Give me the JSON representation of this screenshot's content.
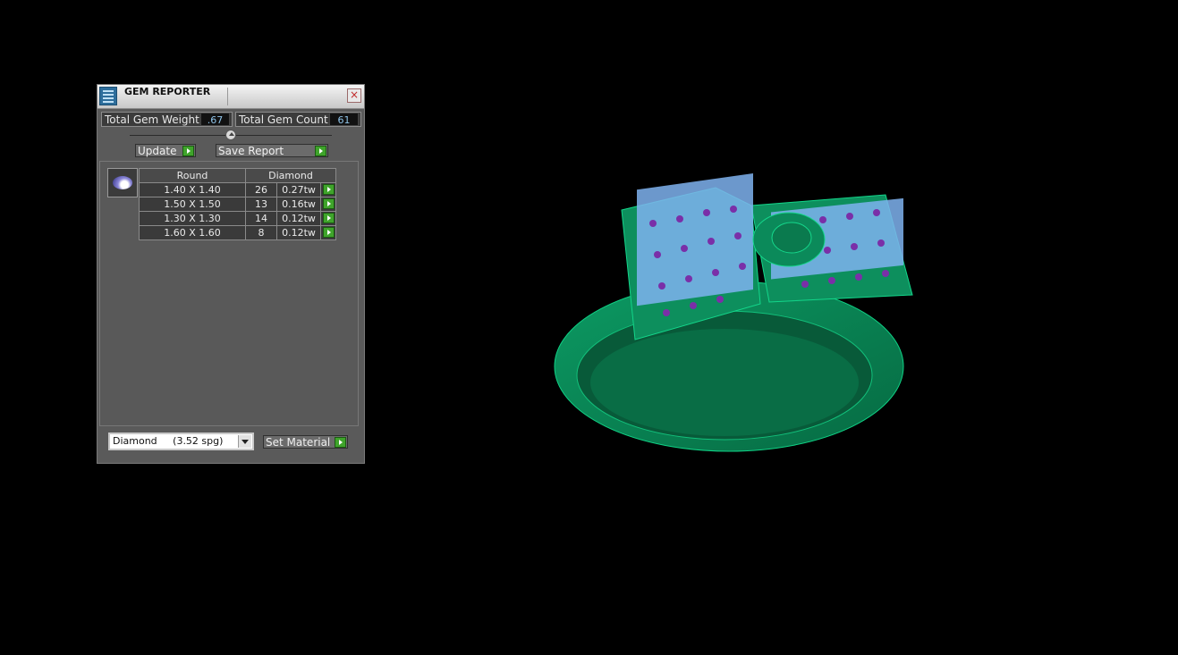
{
  "window": {
    "title": "GEM REPORTER",
    "close_icon": "×"
  },
  "summary": {
    "weight_label": "Total Gem Weight",
    "weight_value": ".67",
    "count_label": "Total Gem Count",
    "count_value": "61"
  },
  "toolbar": {
    "update_label": "Update",
    "save_report_label": "Save Report"
  },
  "table": {
    "headers": [
      "Round",
      "Diamond"
    ],
    "rows": [
      {
        "size": "1.40 X 1.40",
        "count": "26",
        "weight": "0.27tw"
      },
      {
        "size": "1.50 X 1.50",
        "count": "13",
        "weight": "0.16tw"
      },
      {
        "size": "1.30 X 1.30",
        "count": "14",
        "weight": "0.12tw"
      },
      {
        "size": "1.60 X 1.60",
        "count": "8",
        "weight": "0.12tw"
      }
    ]
  },
  "material": {
    "selected": "Diamond     (3.52 spg)",
    "set_label": "Set Material"
  },
  "colors": {
    "ring_green": "#0b8a5a",
    "gem_blue": "#7fb3f0",
    "gem_purple": "#7a2fa8",
    "go_button": "#3fa42b"
  },
  "icons": {
    "app": "gem-reporter-icon",
    "gem_shape": "round-gem-icon",
    "go": "green-arrow-icon"
  }
}
